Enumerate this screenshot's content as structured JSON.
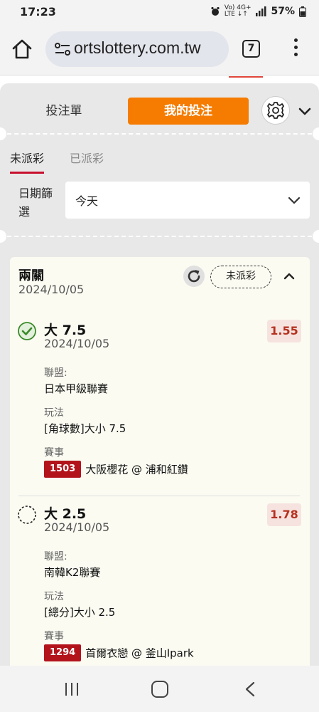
{
  "status_bar": {
    "time": "17:23",
    "network_small": "Vo) 4G+\nLTE ↓↑",
    "battery": "57%"
  },
  "browser": {
    "url": "ortslottery.com.tw",
    "tab_count": "7"
  },
  "betslip_tabs": {
    "slip_label": "投注單",
    "mybets_label": "我的投注"
  },
  "status_tabs": {
    "unsettled": "未派彩",
    "settled": "已派彩"
  },
  "date_filter": {
    "label": "日期篩選",
    "value": "今天"
  },
  "bet_card": {
    "type": "兩關",
    "date": "2024/10/05",
    "status": "未派彩",
    "selections": [
      {
        "name": "大 7.5",
        "date": "2024/10/05",
        "odds": "1.55",
        "settled_icon": "check-circle-icon",
        "league_label": "聯盟:",
        "league": "日本甲級聯賽",
        "market_label": "玩法",
        "market": "[角球數]大小 7.5",
        "event_label": "賽事",
        "match_id": "1503",
        "match": "大阪櫻花 @ 浦和紅鑽"
      },
      {
        "name": "大 2.5",
        "date": "2024/10/05",
        "odds": "1.78",
        "settled_icon": "pending-circle-icon",
        "league_label": "聯盟:",
        "league": "南韓K2聯賽",
        "market_label": "玩法",
        "market": "[總分]大小 2.5",
        "event_label": "賽事",
        "match_id": "1294",
        "match": "首爾衣戀 @ 釜山Ipark"
      }
    ]
  },
  "colors": {
    "accent_orange": "#f57c00",
    "accent_red": "#c8102e",
    "odds_red": "#b5301f"
  }
}
